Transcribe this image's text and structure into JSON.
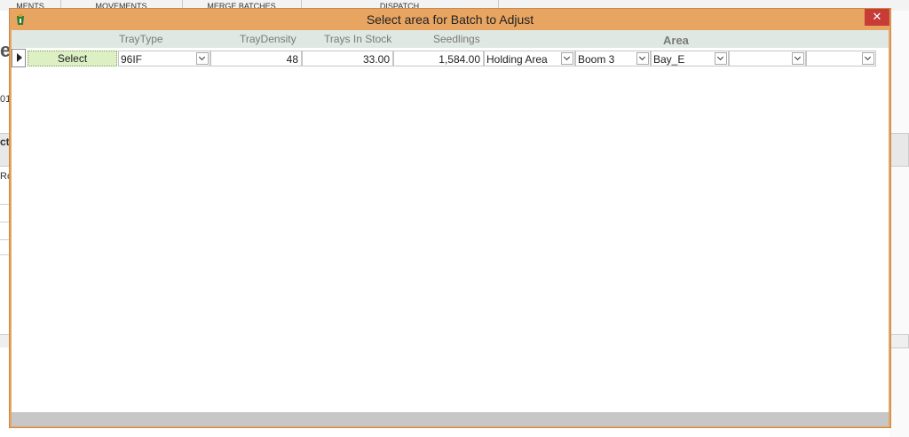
{
  "background": {
    "tabs": [
      "MENTS",
      "MOVEMENTS",
      "MERGE BATCHES",
      "DISPATCH"
    ],
    "left_fragments": [
      "e",
      "01",
      "ct",
      "Ro"
    ]
  },
  "window": {
    "title": "Select area for Batch  to Adjust",
    "close_label": "✕"
  },
  "columns": {
    "tray_type": "TrayType",
    "tray_density": "TrayDensity",
    "trays_in_stock": "Trays In Stock",
    "seedlings": "Seedlings",
    "area": "Area"
  },
  "row": {
    "select_label": "Select",
    "tray_type": "96IF",
    "tray_density": "48",
    "trays_in_stock": "33.00",
    "seedlings": "1,584.00",
    "area_1": "Holding Area",
    "area_2": "Boom 3",
    "area_3": "Bay_E",
    "area_4": "",
    "area_5": "",
    "area_6": ""
  },
  "colors": {
    "window_frame": "#e8a562",
    "close_button": "#c73c36",
    "header_row": "#dfe8e3",
    "select_button": "#dcf0c4"
  }
}
